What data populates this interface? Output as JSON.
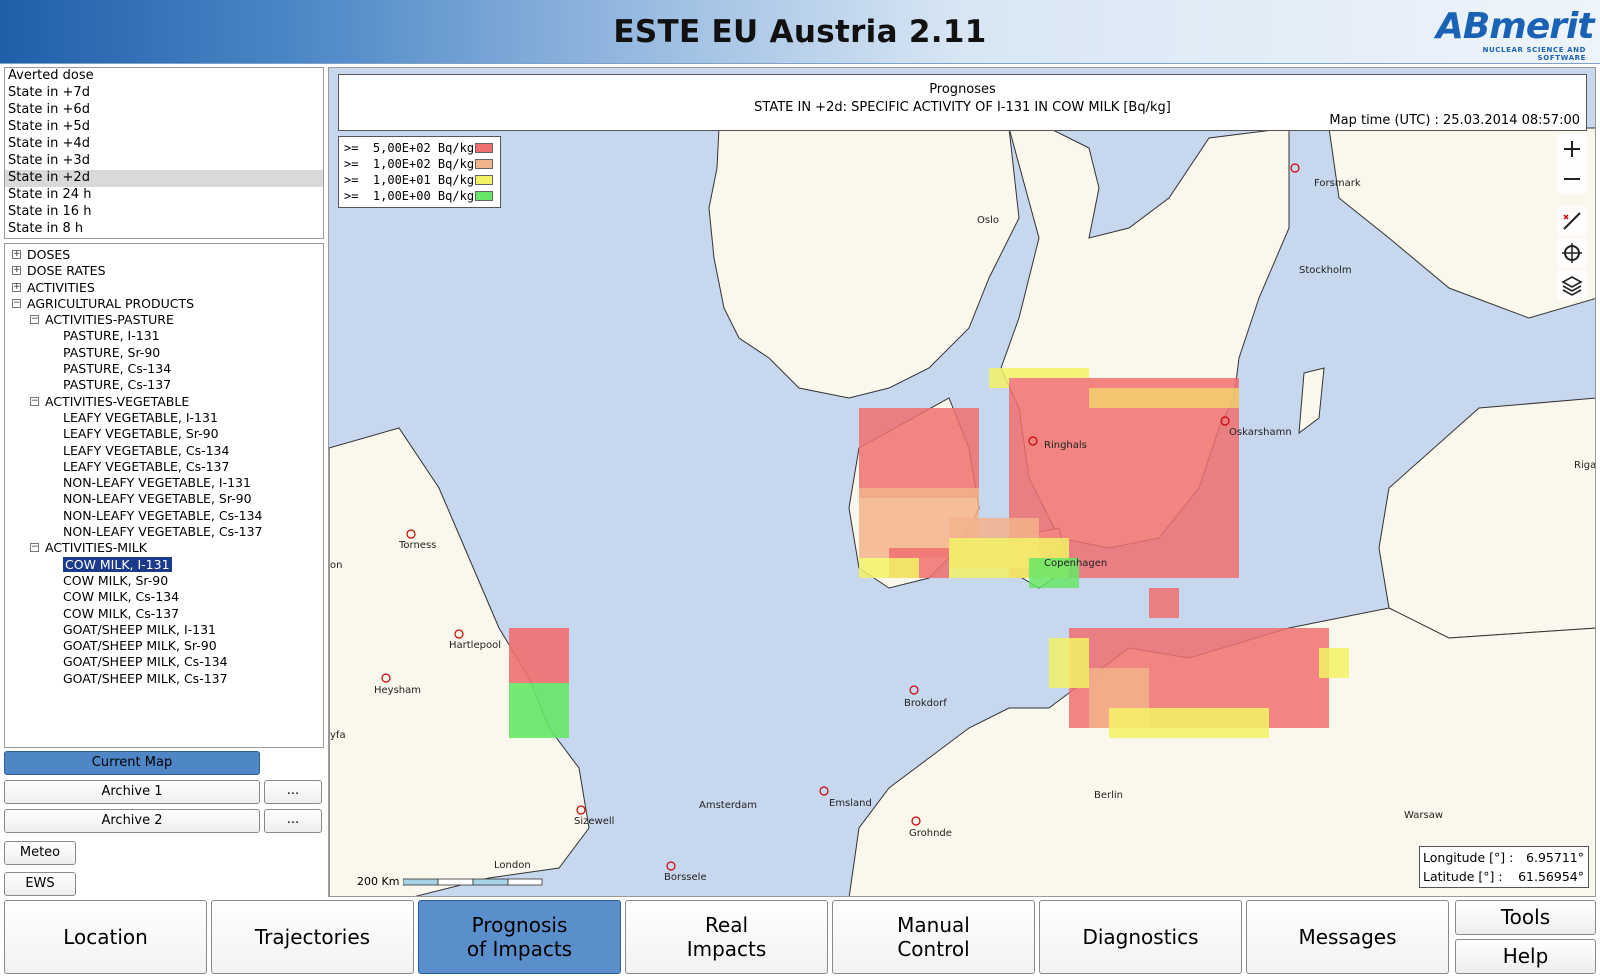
{
  "app": {
    "title": "ESTE EU Austria 2.11",
    "logo_word": "ABmerit",
    "logo_tagline": "NUCLEAR SCIENCE AND SOFTWARE"
  },
  "state_list": [
    {
      "label": "Averted dose"
    },
    {
      "label": "State in +7d"
    },
    {
      "label": "State in +6d"
    },
    {
      "label": "State in +5d"
    },
    {
      "label": "State in +4d"
    },
    {
      "label": "State in +3d"
    },
    {
      "label": "State in +2d",
      "selected": true
    },
    {
      "label": "State in 24 h"
    },
    {
      "label": "State in 16 h"
    },
    {
      "label": "State in 8 h"
    }
  ],
  "tree": [
    {
      "label": "DOSES",
      "level": 0,
      "toggle": "+"
    },
    {
      "label": "DOSE RATES",
      "level": 0,
      "toggle": "+"
    },
    {
      "label": "ACTIVITIES",
      "level": 0,
      "toggle": "+"
    },
    {
      "label": "AGRICULTURAL PRODUCTS",
      "level": 0,
      "toggle": "−"
    },
    {
      "label": "ACTIVITIES-PASTURE",
      "level": 1,
      "toggle": "−"
    },
    {
      "label": "PASTURE, I-131",
      "level": 2
    },
    {
      "label": "PASTURE, Sr-90",
      "level": 2
    },
    {
      "label": "PASTURE, Cs-134",
      "level": 2
    },
    {
      "label": "PASTURE, Cs-137",
      "level": 2
    },
    {
      "label": "ACTIVITIES-VEGETABLE",
      "level": 1,
      "toggle": "−"
    },
    {
      "label": "LEAFY VEGETABLE, I-131",
      "level": 2
    },
    {
      "label": "LEAFY VEGETABLE, Sr-90",
      "level": 2
    },
    {
      "label": "LEAFY VEGETABLE, Cs-134",
      "level": 2
    },
    {
      "label": "LEAFY VEGETABLE, Cs-137",
      "level": 2
    },
    {
      "label": "NON-LEAFY VEGETABLE, I-131",
      "level": 2
    },
    {
      "label": "NON-LEAFY VEGETABLE, Sr-90",
      "level": 2
    },
    {
      "label": "NON-LEAFY VEGETABLE, Cs-134",
      "level": 2
    },
    {
      "label": "NON-LEAFY VEGETABLE, Cs-137",
      "level": 2
    },
    {
      "label": "ACTIVITIES-MILK",
      "level": 1,
      "toggle": "−"
    },
    {
      "label": "COW MILK, I-131",
      "level": 2,
      "selected": true
    },
    {
      "label": "COW MILK, Sr-90",
      "level": 2
    },
    {
      "label": "COW MILK, Cs-134",
      "level": 2
    },
    {
      "label": "COW MILK, Cs-137",
      "level": 2
    },
    {
      "label": "GOAT/SHEEP  MILK, I-131",
      "level": 2
    },
    {
      "label": "GOAT/SHEEP  MILK, Sr-90",
      "level": 2
    },
    {
      "label": "GOAT/SHEEP  MILK, Cs-134",
      "level": 2
    },
    {
      "label": "GOAT/SHEEP  MILK, Cs-137",
      "level": 2
    }
  ],
  "map_buttons": {
    "current_map": "Current Map",
    "archive1": "Archive 1",
    "archive2": "Archive 2",
    "more": "...",
    "meteo": "Meteo",
    "ews": "EWS"
  },
  "map": {
    "heading": "Prognoses",
    "subheading": "STATE IN  +2d: SPECIFIC ACTIVITY OF I-131 IN COW MILK [Bq/kg]",
    "map_time": "Map time (UTC) : 25.03.2014 08:57:00",
    "legend": [
      {
        "label": ">=  5,00E+02 Bq/kg",
        "color": "#f07070"
      },
      {
        "label": ">=  1,00E+02 Bq/kg",
        "color": "#f3b38b"
      },
      {
        "label": ">=  1,00E+01 Bq/kg",
        "color": "#f2f266"
      },
      {
        "label": ">=  1,00E+00 Bq/kg",
        "color": "#66e666"
      }
    ],
    "places": [
      "Oslo",
      "Forsmark",
      "Stockholm",
      "Ringhals",
      "Oskarshamn",
      "Riga",
      "Copenhagen",
      "Torness",
      "Hartlepool",
      "Heysham",
      "Brokdorf",
      "Berlin",
      "Emsland",
      "Amsterdam",
      "Grohnde",
      "Sizewell",
      "Warsaw",
      "Borssele",
      "London"
    ],
    "edge_labels": [
      "on",
      "yfa"
    ],
    "scale_label": "200 Km",
    "longitude_label": "Longitude [°]  :",
    "longitude_value": "6.95711°",
    "latitude_label": "Latitude [°]   :",
    "latitude_value": "61.56954°",
    "icons": [
      "zoom-in-icon",
      "zoom-out-icon",
      "measure-icon",
      "locate-icon",
      "layers-icon"
    ]
  },
  "nav": [
    {
      "label": "Location"
    },
    {
      "label": "Trajectories"
    },
    {
      "label": "Prognosis\nof Impacts",
      "active": true
    },
    {
      "label": "Real\nImpacts"
    },
    {
      "label": "Manual\nControl"
    },
    {
      "label": "Diagnostics"
    },
    {
      "label": "Messages"
    }
  ],
  "side_nav": {
    "tools": "Tools",
    "help": "Help"
  }
}
